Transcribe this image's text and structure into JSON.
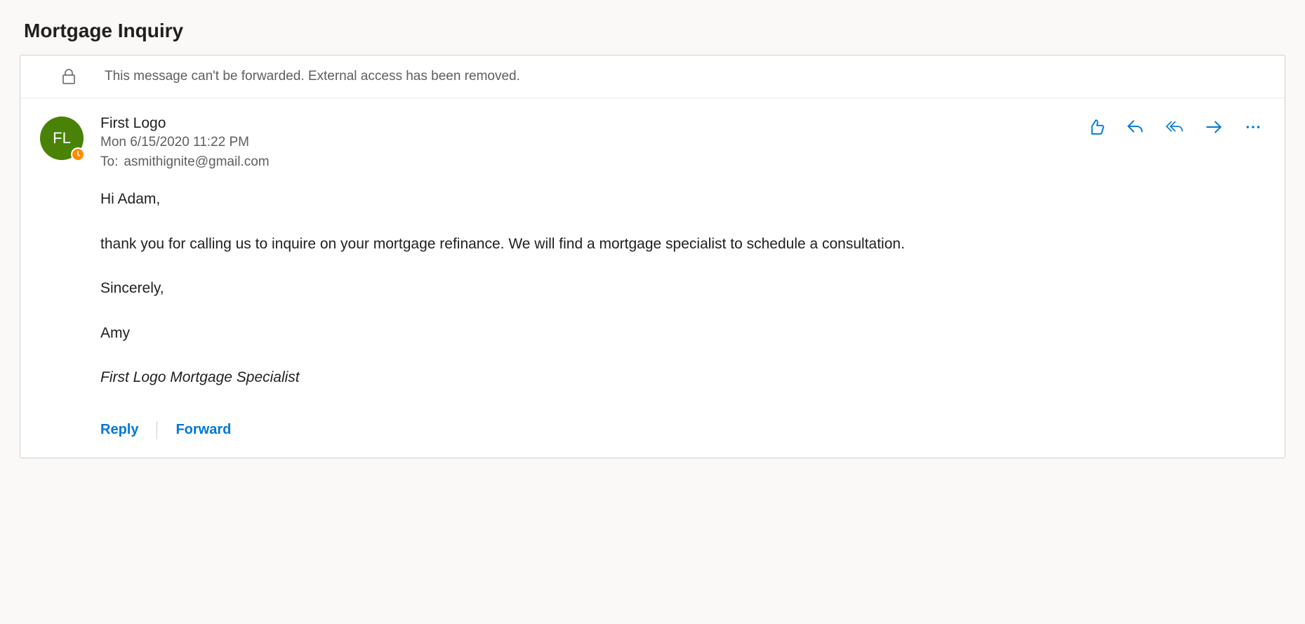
{
  "subject": "Mortgage Inquiry",
  "banner": {
    "text": "This message can't be forwarded. External access has been removed."
  },
  "sender": {
    "name": "First Logo",
    "initials": "FL"
  },
  "datetime": "Mon 6/15/2020 11:22 PM",
  "to": {
    "label": "To:",
    "value": "asmithignite@gmail.com"
  },
  "body": {
    "greeting": "Hi Adam,",
    "line1": " thank you for calling us to inquire on your mortgage refinance.  We will find a mortgage specialist to schedule a consultation.",
    "closing": "Sincerely,",
    "signer": "Amy",
    "title": "First Logo Mortgage Specialist"
  },
  "footer": {
    "reply": "Reply",
    "forward": "Forward"
  }
}
